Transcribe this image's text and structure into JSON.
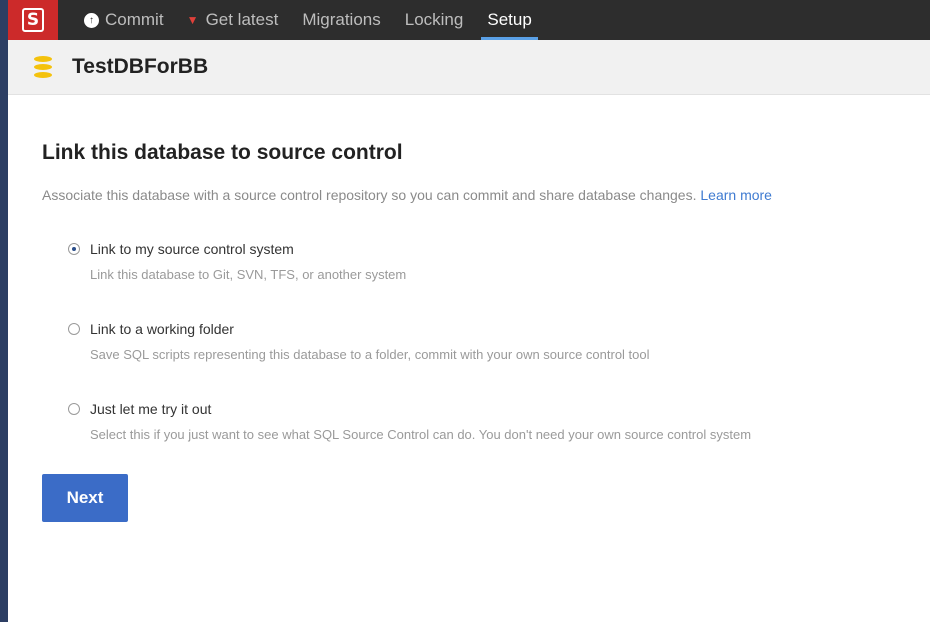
{
  "topbar": {
    "logo_letter": "S",
    "nav": [
      {
        "label": "Commit",
        "icon": "commit-icon"
      },
      {
        "label": "Get latest",
        "icon": "get-latest-icon"
      },
      {
        "label": "Migrations"
      },
      {
        "label": "Locking"
      },
      {
        "label": "Setup",
        "active": true
      }
    ]
  },
  "database": {
    "name": "TestDBForBB",
    "icon": "database-icon"
  },
  "main": {
    "heading": "Link this database to source control",
    "description": "Associate this database with a source control repository so you can commit and share database changes.",
    "learn_more": "Learn more",
    "options": [
      {
        "label": "Link to my source control system",
        "sub": "Link this database to Git, SVN, TFS, or another system",
        "selected": true
      },
      {
        "label": "Link to a working folder",
        "sub": "Save SQL scripts representing this database to a folder, commit with your own source control tool",
        "selected": false
      },
      {
        "label": "Just let me try it out",
        "sub": "Select this if you just want to see what SQL Source Control can do. You don't need your own source control system",
        "selected": false
      }
    ],
    "next_label": "Next"
  },
  "colors": {
    "topbar_bg": "#2d2d2d",
    "logo_red": "#cc2a2a",
    "active_underline": "#5aa0e6",
    "primary_button": "#3b6cc7",
    "link": "#3f7bd1",
    "db_icon": "#f4c20d"
  }
}
